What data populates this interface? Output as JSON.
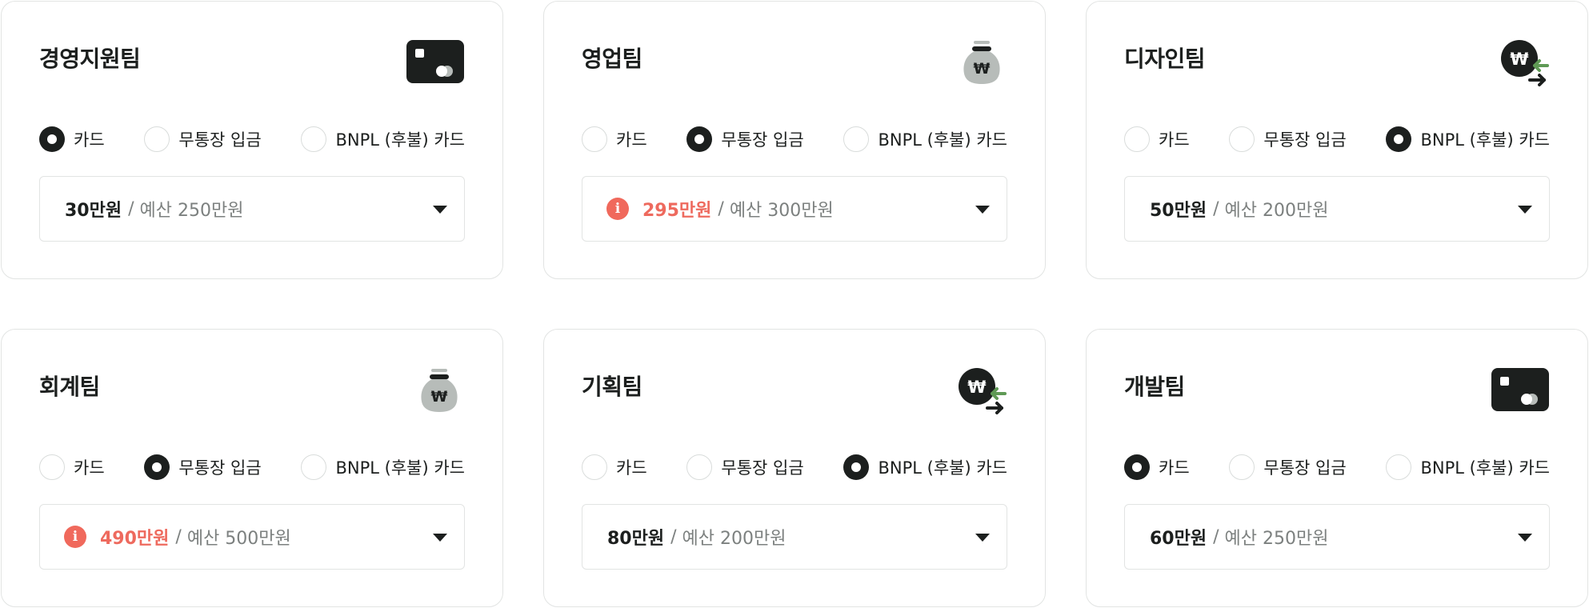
{
  "teams": [
    {
      "name": "경영지원팀",
      "icon": "credit-card-icon",
      "options": [
        "카드",
        "무통장 입금",
        "BNPL (후불) 카드"
      ],
      "selected_option": "카드",
      "spent": "30만원",
      "separator": "/",
      "budget": "예산 250만원",
      "over_budget": false
    },
    {
      "name": "영업팀",
      "icon": "money-bag-icon",
      "options": [
        "카드",
        "무통장 입금",
        "BNPL (후불) 카드"
      ],
      "selected_option": "무통장 입금",
      "spent": "295만원",
      "separator": "/",
      "budget": "예산 300만원",
      "over_budget": true
    },
    {
      "name": "디자인팀",
      "icon": "won-transfer-icon",
      "options": [
        "카드",
        "무통장 입금",
        "BNPL (후불) 카드"
      ],
      "selected_option": "BNPL (후불) 카드",
      "spent": "50만원",
      "separator": "/",
      "budget": "예산 200만원",
      "over_budget": false
    },
    {
      "name": "회계팀",
      "icon": "money-bag-icon",
      "options": [
        "카드",
        "무통장 입금",
        "BNPL (후불) 카드"
      ],
      "selected_option": "무통장 입금",
      "spent": "490만원",
      "separator": "/",
      "budget": "예산 500만원",
      "over_budget": true
    },
    {
      "name": "기획팀",
      "icon": "won-transfer-icon",
      "options": [
        "카드",
        "무통장 입금",
        "BNPL (후불) 카드"
      ],
      "selected_option": "BNPL (후불) 카드",
      "spent": "80만원",
      "separator": "/",
      "budget": "예산 200만원",
      "over_budget": false
    },
    {
      "name": "개발팀",
      "icon": "credit-card-icon",
      "options": [
        "카드",
        "무통장 입금",
        "BNPL (후불) 카드"
      ],
      "selected_option": "카드",
      "spent": "60만원",
      "separator": "/",
      "budget": "예산 250만원",
      "over_budget": false
    }
  ],
  "colors": {
    "text": "#1c1f1e",
    "muted": "#7c807f",
    "warning": "#ee6a5e",
    "border": "#e2e4e3",
    "icon_dark": "#1c1f1e",
    "icon_gray": "#b7bcb9",
    "icon_green": "#5f9a55"
  }
}
